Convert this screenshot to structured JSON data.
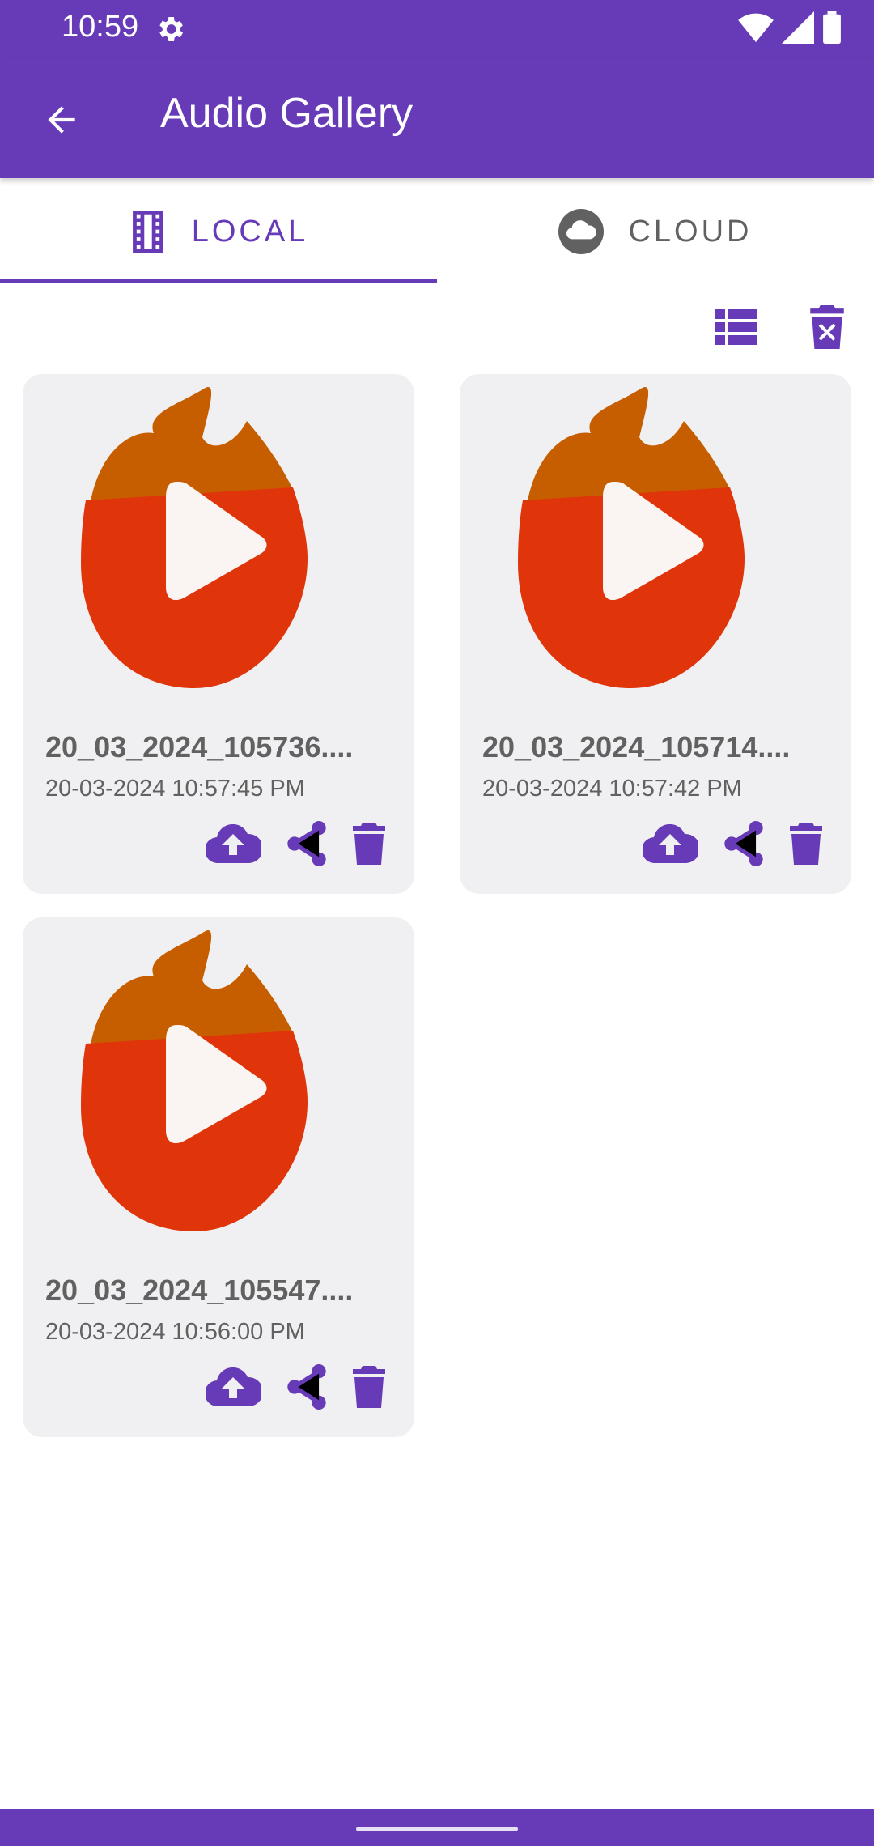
{
  "status_bar": {
    "time": "10:59"
  },
  "app_bar": {
    "title": "Audio Gallery"
  },
  "tabs": [
    {
      "label": "LOCAL",
      "icon": "film-icon",
      "selected": true
    },
    {
      "label": "CLOUD",
      "icon": "cloud-icon",
      "selected": false
    }
  ],
  "toolbar": {
    "actions": [
      "list-view-icon",
      "delete-all-icon"
    ]
  },
  "items": [
    {
      "title": "20_03_2024_105736....",
      "date": "20-03-2024 10:57:45 PM"
    },
    {
      "title": "20_03_2024_105714....",
      "date": "20-03-2024 10:57:42 PM"
    },
    {
      "title": "20_03_2024_105547....",
      "date": "20-03-2024 10:56:00 PM"
    }
  ],
  "colors": {
    "primary": "#673AB7",
    "flame_top": "#C65E00",
    "flame_body": "#E0340A",
    "card_bg": "#F0F0F2",
    "text_gray": "#616161"
  }
}
